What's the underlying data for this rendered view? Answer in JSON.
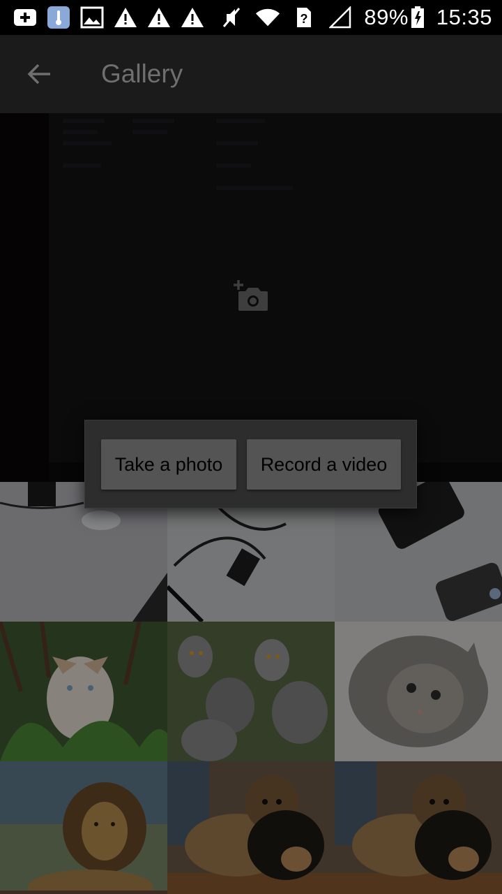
{
  "status_bar": {
    "battery": "89%",
    "time": "15:35"
  },
  "app_bar": {
    "title": "Gallery",
    "back_icon": "arrow-back-icon"
  },
  "camera_tile": {
    "icon": "camera-add-icon"
  },
  "dialog": {
    "take_photo_label": "Take a photo",
    "record_video_label": "Record a video"
  },
  "thumbnails": [
    "desk-mouse",
    "desk-cables",
    "desk-phone",
    "cat-in-plants",
    "lemurs",
    "kitten",
    "lion",
    "puppies",
    "puppies"
  ],
  "colors": {
    "status_bar": "#000000",
    "app_bar": "#1b1b1b",
    "dialog": "#2d2d2d",
    "dialog_button": "#545454"
  }
}
